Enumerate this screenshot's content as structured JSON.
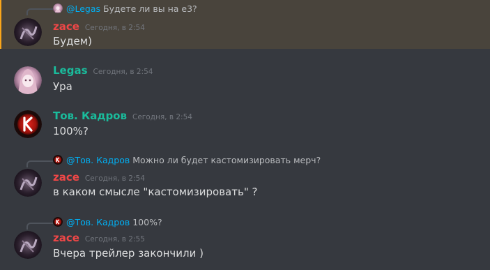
{
  "colors": {
    "zace": "#f04747",
    "legas": "#1abc9c",
    "kadrov": "#1abc9c",
    "mention": "#00b0f4",
    "highlight_bg": "#49443c",
    "highlight_bar": "#faa61a"
  },
  "messages": [
    {
      "reply": {
        "mention": "@Legas",
        "text": "Будете ли вы на e3?",
        "avatar_icon": "legas-avatar-icon"
      },
      "author": "zace",
      "timestamp": "Сегодня, в 2:54",
      "content": "Будем)",
      "highlighted": true,
      "avatar_icon": "zace-avatar-icon"
    },
    {
      "author": "Legas",
      "timestamp": "Сегодня, в 2:54",
      "content": "Ура",
      "avatar_icon": "legas-avatar-icon"
    },
    {
      "author": "Тов. Кадров",
      "timestamp": "Сегодня, в 2:54",
      "content": "100%?",
      "avatar_icon": "kadrov-avatar-icon"
    },
    {
      "reply": {
        "mention": "@Тов. Кадров",
        "text": "Можно ли будет кастомизировать мерч?",
        "avatar_icon": "kadrov-avatar-icon"
      },
      "author": "zace",
      "timestamp": "Сегодня, в 2:54",
      "content": "в каком смысле \"кастомизировать\" ?",
      "avatar_icon": "zace-avatar-icon"
    },
    {
      "reply": {
        "mention": "@Тов. Кадров",
        "text": "100%?",
        "avatar_icon": "kadrov-avatar-icon"
      },
      "author": "zace",
      "timestamp": "Сегодня, в 2:55",
      "content": "Вчера трейлер закончили )",
      "avatar_icon": "zace-avatar-icon"
    }
  ]
}
